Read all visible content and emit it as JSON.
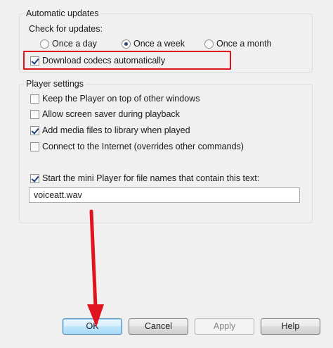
{
  "automatic_updates": {
    "legend": "Automatic updates",
    "check_label": "Check for updates:",
    "options": [
      {
        "label": "Once a day",
        "selected": false
      },
      {
        "label": "Once a week",
        "selected": true
      },
      {
        "label": "Once a month",
        "selected": false
      }
    ],
    "download_codecs": {
      "label": "Download codecs automatically",
      "checked": true
    }
  },
  "player_settings": {
    "legend": "Player settings",
    "items": [
      {
        "label": "Keep the Player on top of other windows",
        "checked": false
      },
      {
        "label": "Allow screen saver during playback",
        "checked": false
      },
      {
        "label": "Add media files to library when played",
        "checked": true
      },
      {
        "label": "Connect to the Internet (overrides other commands)",
        "checked": false
      }
    ],
    "mini_player": {
      "label": "Start the mini Player for file names that contain this text:",
      "checked": true
    },
    "mini_player_text": "voiceatt.wav"
  },
  "buttons": {
    "ok": "OK",
    "cancel": "Cancel",
    "apply": "Apply",
    "help": "Help"
  },
  "colors": {
    "highlight": "#e0141e",
    "arrow": "#e0141e"
  }
}
